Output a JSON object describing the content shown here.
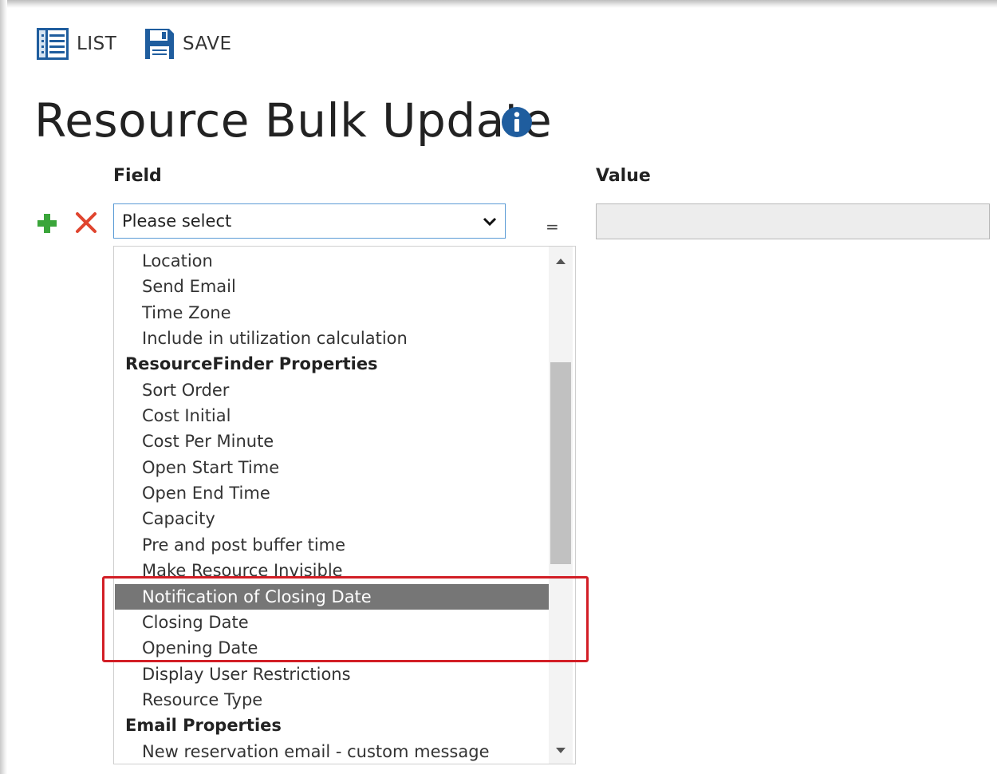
{
  "toolbar": {
    "list_label": "LIST",
    "save_label": "SAVE",
    "list_icon": "list-icon",
    "save_icon": "floppy-disk-icon"
  },
  "page": {
    "title": "Resource Bulk Update",
    "info_icon": "info-icon"
  },
  "columns": {
    "field_header": "Field",
    "value_header": "Value"
  },
  "row": {
    "add_icon": "plus-icon",
    "remove_icon": "close-icon",
    "field_select_value": "Please select",
    "operator": "=",
    "value_input_value": ""
  },
  "dropdown": {
    "options": [
      {
        "label": "Location",
        "type": "option"
      },
      {
        "label": "Send Email",
        "type": "option"
      },
      {
        "label": "Time Zone",
        "type": "option"
      },
      {
        "label": "Include in utilization calculation",
        "type": "option"
      },
      {
        "label": "ResourceFinder Properties",
        "type": "group"
      },
      {
        "label": "Sort Order",
        "type": "option"
      },
      {
        "label": "Cost Initial",
        "type": "option"
      },
      {
        "label": "Cost Per Minute",
        "type": "option"
      },
      {
        "label": "Open Start Time",
        "type": "option"
      },
      {
        "label": "Open End Time",
        "type": "option"
      },
      {
        "label": "Capacity",
        "type": "option"
      },
      {
        "label": "Pre and post buffer time",
        "type": "option"
      },
      {
        "label": "Make Resource Invisible",
        "type": "option"
      },
      {
        "label": "Notification of Closing Date",
        "type": "option",
        "selected": true
      },
      {
        "label": "Closing Date",
        "type": "option"
      },
      {
        "label": "Opening Date",
        "type": "option"
      },
      {
        "label": "Display User Restrictions",
        "type": "option"
      },
      {
        "label": "Resource Type",
        "type": "option"
      },
      {
        "label": "Email Properties",
        "type": "group"
      },
      {
        "label": "New reservation email - custom message",
        "type": "option"
      }
    ],
    "highlight_color": "#d21e26",
    "selected_bg": "#767676"
  },
  "colors": {
    "accent_blue": "#1f5d9e",
    "add_green": "#3aa53a",
    "remove_red": "#e0442e"
  }
}
